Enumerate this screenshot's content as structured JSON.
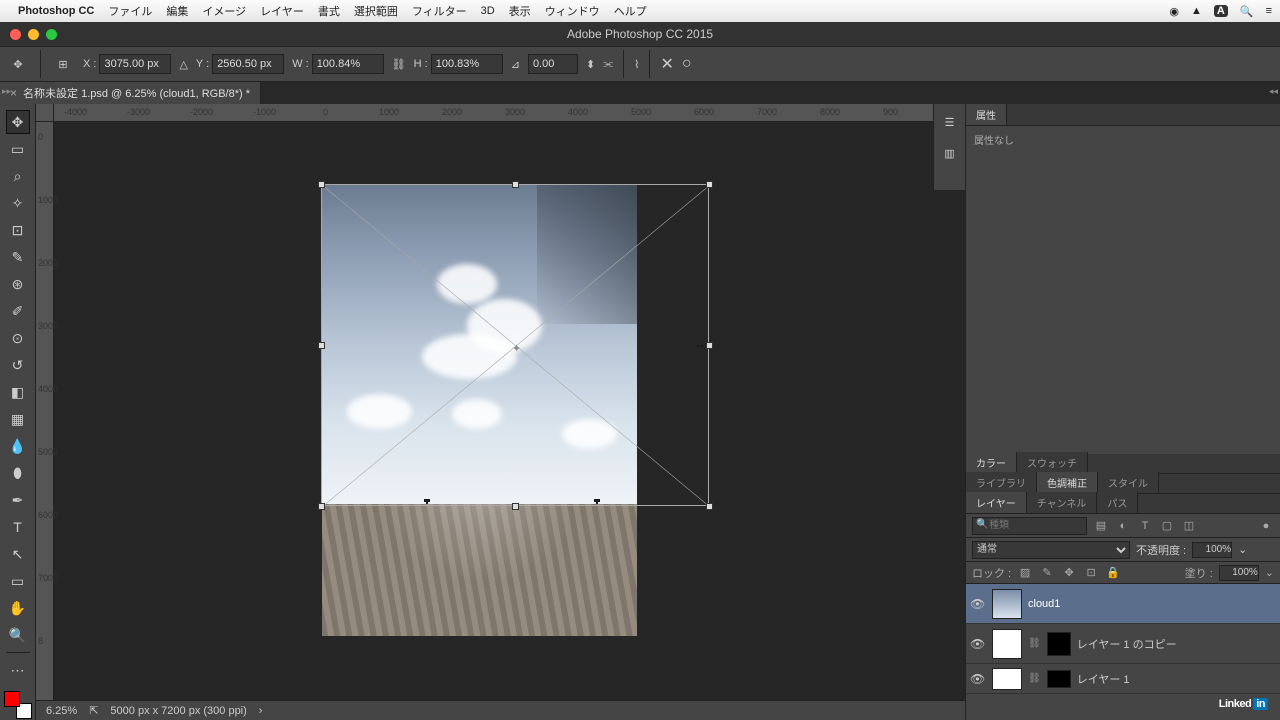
{
  "menubar": {
    "app": "Photoshop CC",
    "items": [
      "ファイル",
      "編集",
      "イメージ",
      "レイヤー",
      "書式",
      "選択範囲",
      "フィルター",
      "3D",
      "表示",
      "ウィンドウ",
      "ヘルプ"
    ],
    "right_badge": "A"
  },
  "window_title": "Adobe Photoshop CC 2015",
  "options": {
    "x_label": "X :",
    "x": "3075.00 px",
    "y_label": "Y :",
    "y": "2560.50 px",
    "w_label": "W :",
    "w": "100.84%",
    "h_label": "H :",
    "h": "100.83%",
    "angle_label": "",
    "angle": "0.00"
  },
  "doc_tab": {
    "title": "名称未設定 1.psd @ 6.25% (cloud1, RGB/8*) *"
  },
  "ruler_h": [
    "-4000",
    "-3000",
    "-2000",
    "-1000",
    "0",
    "1000",
    "2000",
    "3000",
    "4000",
    "5000",
    "6000",
    "7000",
    "8000",
    "900"
  ],
  "ruler_v": [
    "0",
    "1000",
    "2000",
    "3000",
    "4000",
    "5000",
    "6000",
    "7000",
    "8"
  ],
  "status": {
    "zoom": "6.25%",
    "docinfo": "5000 px x 7200 px (300 ppi)"
  },
  "panels": {
    "attrs_tab": "属性",
    "attrs_empty": "属性なし",
    "color_tabs": [
      "カラー",
      "スウォッチ"
    ],
    "lib_tabs": [
      "ライブラリ",
      "色調補正",
      "スタイル"
    ],
    "layer_tabs": [
      "レイヤー",
      "チャンネル",
      "パス"
    ],
    "search_placeholder": "種類",
    "blend_mode": "通常",
    "opacity_label": "不透明度 :",
    "opacity": "100%",
    "lock_label": "ロック :",
    "fill_label": "塗り :",
    "fill": "100%",
    "layers": [
      {
        "name": "cloud1",
        "active": true
      },
      {
        "name": "レイヤー 1 のコピー",
        "active": false,
        "linked": true,
        "mask": true
      },
      {
        "name": "レイヤー 1",
        "active": false,
        "linked": true,
        "mask": true
      }
    ]
  },
  "watermark": "Linked"
}
